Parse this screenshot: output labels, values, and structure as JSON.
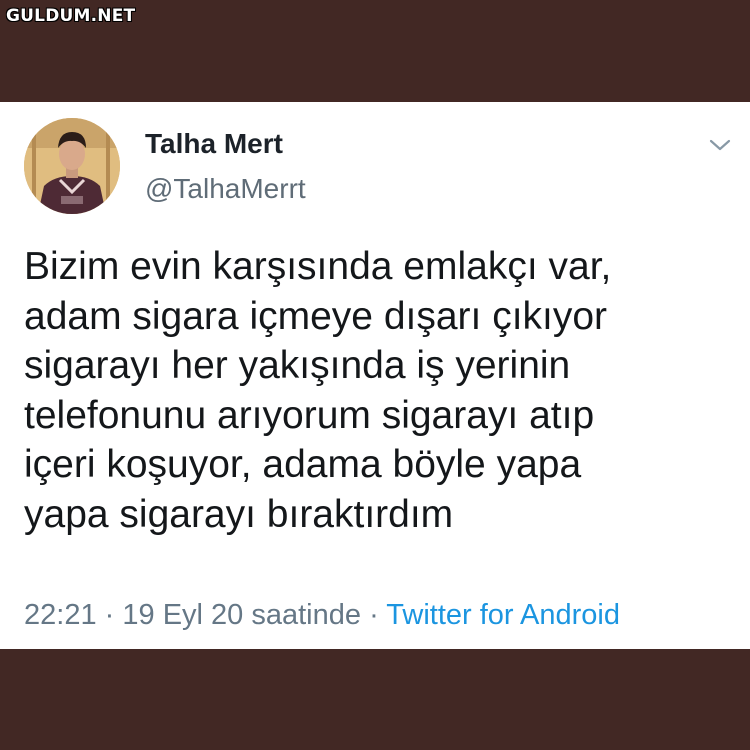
{
  "watermark": "GULDUM.NET",
  "tweet": {
    "display_name": "Talha Mert",
    "handle": "@TalhaMerrt",
    "text_lines": [
      "Bizim evin karşısında emlakçı var,",
      "adam sigara içmeye dışarı çıkıyor",
      "sigarayı her yakışında iş yerinin",
      "telefonunu arıyorum sigarayı atıp",
      "içeri koşuyor, adama böyle yapa",
      "yapa sigarayı bıraktırdım"
    ],
    "time": "22:21",
    "separator": "·",
    "date": "19 Eyl 20 saatinde",
    "source": "Twitter for Android"
  },
  "icons": {
    "menu": "chevron-down-icon",
    "avatar": "profile-photo"
  },
  "colors": {
    "background": "#422824",
    "card": "#ffffff",
    "text": "#14171a",
    "muted": "#657786",
    "link": "#1b95e0"
  }
}
